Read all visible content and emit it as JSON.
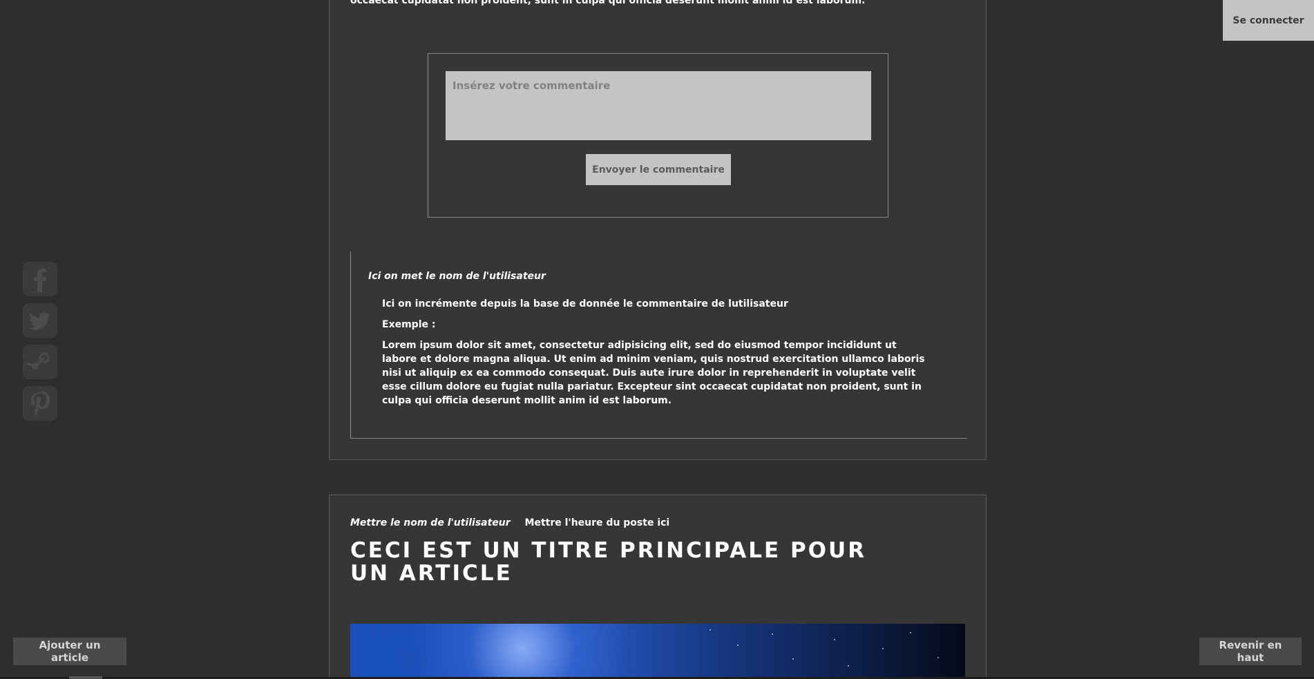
{
  "auth": {
    "login_label": "Se connecter"
  },
  "post1": {
    "excerpt": "aute irure dolor in reprehenderit in voluptate velit esse cillum dolore eu fugiat nulla pariatur. Excepteur sint occaecat cupidatat non proident, sunt in culpa qui officia deserunt mollit anim id est laborum.",
    "comment_form": {
      "placeholder": "Insérez votre commentaire",
      "value": "",
      "submit_label": "Envoyer le commentaire"
    },
    "comment": {
      "user": "Ici on met le nom de l'utilisateur",
      "line1": "Ici on incrémente depuis la base de donnée le commentaire de lutilisateur",
      "line2": "Exemple :",
      "line3": "Lorem ipsum dolor sit amet, consectetur adipisicing elit, sed do eiusmod tempor incididunt ut labore et dolore magna aliqua. Ut enim ad minim veniam, quis nostrud exercitation ullamco laboris nisi ut aliquip ex ea commodo consequat. Duis aute irure dolor in reprehenderit in voluptate velit esse cillum dolore eu fugiat nulla pariatur. Excepteur sint occaecat cupidatat non proident, sunt in culpa qui officia deserunt mollit anim id est laborum."
    }
  },
  "post2": {
    "user": "Mettre le nom de l'utilisateur",
    "time": "Mettre l'heure du poste ici",
    "title": "Ceci est un titre principale pour un article"
  },
  "social": {
    "items": [
      {
        "icon": "facebook-icon"
      },
      {
        "icon": "twitter-icon"
      },
      {
        "icon": "steam-icon"
      },
      {
        "icon": "pinterest-icon"
      }
    ],
    "color": "#4a4a4a"
  },
  "actions": {
    "add_article_label": "Ajouter un article",
    "back_to_top_label": "Revenir en haut"
  },
  "colors": {
    "background": "#2e2e2e",
    "card": "#363636",
    "button_light": "#c4c4c4",
    "button_dark": "#4a4a4a"
  }
}
